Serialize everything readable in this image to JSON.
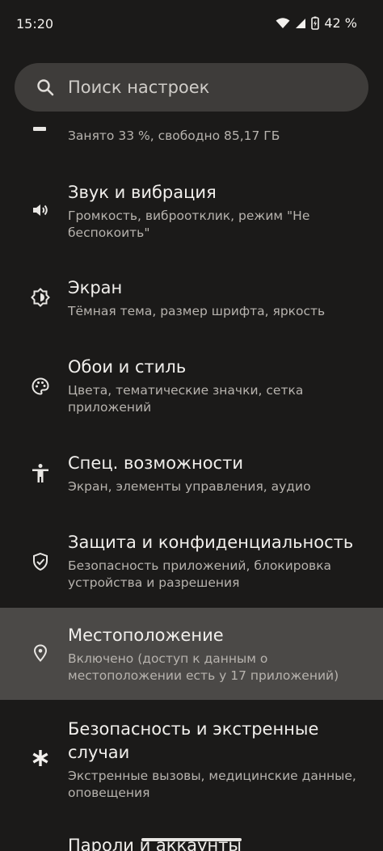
{
  "status_bar": {
    "time": "15:20",
    "battery_percent": "42 %",
    "icons": [
      "wifi-icon",
      "cellular-icon",
      "battery-charging-icon"
    ]
  },
  "search": {
    "placeholder": "Поиск настроек",
    "icon": "search-icon"
  },
  "settings_items": [
    {
      "icon": "storage-icon",
      "title": "",
      "summary": "Занято 33 %, свободно 85,17 ГБ"
    },
    {
      "icon": "volume-icon",
      "title": "Звук и вибрация",
      "summary": "Громкость, виброотклик, режим \"Не беспокоить\""
    },
    {
      "icon": "brightness-icon",
      "title": "Экран",
      "summary": "Тёмная тема, размер шрифта, яркость"
    },
    {
      "icon": "palette-icon",
      "title": "Обои и стиль",
      "summary": "Цвета, тематические значки, сетка приложений"
    },
    {
      "icon": "accessibility-icon",
      "title": "Спец. возможности",
      "summary": "Экран, элементы управления, аудио"
    },
    {
      "icon": "shield-check-icon",
      "title": "Защита и конфиденциальность",
      "summary": "Безопасность приложений, блокировка устройства и разрешения"
    },
    {
      "icon": "location-pin-icon",
      "title": "Местоположение",
      "summary": "Включено (доступ к данным о местоположении есть у 17 приложений)",
      "highlighted": true
    },
    {
      "icon": "emergency-asterisk-icon",
      "title": "Безопасность и экстренные случаи",
      "summary": "Экстренные вызовы, медицинские данные, оповещения"
    },
    {
      "icon": "key-icon",
      "title": "Пароли и аккаунты",
      "summary": ""
    }
  ],
  "colors": {
    "background": "#1b1a19",
    "search_bg": "#3e3c3a",
    "highlight": "#4b4947",
    "title": "#f1efec",
    "summary": "#b7b3ae"
  }
}
